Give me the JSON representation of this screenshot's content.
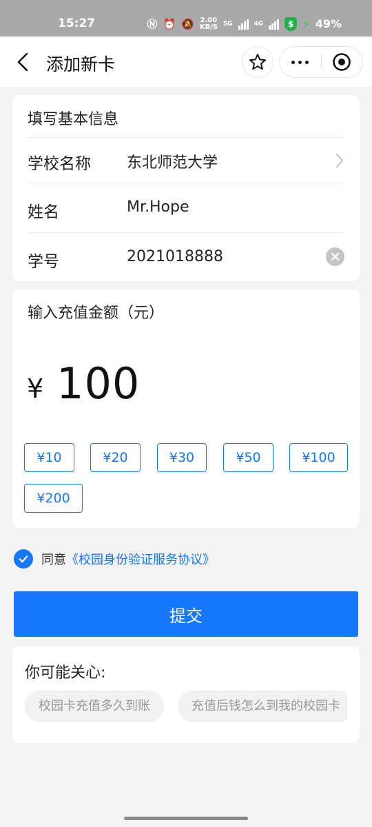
{
  "status_bar": {
    "time": "15:27",
    "network_speed": "2.00 KB/S",
    "signal_labels": [
      "5G",
      "4G"
    ],
    "shield_symbol": "$",
    "battery": "49%"
  },
  "nav": {
    "title": "添加新卡",
    "back_icon": "chevron-left-icon",
    "favorite_icon": "star-icon",
    "more_icon": "ellipsis-icon",
    "close_icon": "target-circle-icon"
  },
  "basic_info": {
    "title": "填写基本信息",
    "school_label": "学校名称",
    "school_value": "东北师范大学",
    "name_label": "姓名",
    "name_value": "Mr.Hope",
    "student_id_label": "学号",
    "student_id_value": "2021018888"
  },
  "recharge": {
    "title": "输入充值金额（元）",
    "currency": "¥",
    "amount": "100",
    "options": [
      "¥10",
      "¥20",
      "¥30",
      "¥50",
      "¥100",
      "¥200"
    ]
  },
  "agreement": {
    "checked": true,
    "prefix": "同意",
    "link": "《校园身份验证服务协议》"
  },
  "submit_label": "提交",
  "faq": {
    "title": "你可能关心:",
    "questions": [
      "校园卡充值多久到账",
      "充值后钱怎么到我的校园卡"
    ]
  },
  "colors": {
    "accent": "#1677ff",
    "status_bar": "#a9a9a9",
    "background": "#f3f3f3"
  }
}
